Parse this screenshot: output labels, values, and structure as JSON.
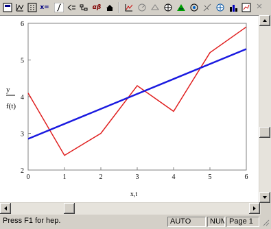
{
  "toolbar": {
    "buttons": [
      "calculator",
      "graph",
      "matrix",
      "evaluation",
      "calculus",
      "boolean",
      "programming",
      "greek",
      "symbolic"
    ],
    "buttons2": [
      "xy-plot",
      "polar-plot",
      "surface-plot",
      "contour-plot",
      "3d-scatter",
      "3d-bar",
      "vector-field"
    ],
    "eval_label": "x=",
    "greek_label": "αβ"
  },
  "plot": {
    "y_label_1": "y",
    "y_label_2": "f(t)",
    "x_label": "x,t",
    "x_ticks": [
      "0",
      "1",
      "2",
      "3",
      "4",
      "5",
      "6"
    ],
    "y_ticks": [
      "2",
      "3",
      "4",
      "5",
      "6"
    ]
  },
  "chart_data": {
    "type": "line",
    "xlim": [
      0,
      6
    ],
    "ylim": [
      2,
      6
    ],
    "xlabel": "x,t",
    "ylabel": "y / f(t)",
    "series": [
      {
        "color": "#e02020",
        "x": [
          0,
          1,
          2,
          3,
          4,
          5,
          6
        ],
        "values": [
          4.1,
          2.4,
          3.0,
          4.3,
          3.6,
          5.2,
          5.9
        ]
      },
      {
        "color": "#1a1ae0",
        "x": [
          0,
          6
        ],
        "values": [
          2.85,
          5.3
        ]
      }
    ]
  },
  "status": {
    "help": "Press F1 for hep.",
    "mode": "AUTO",
    "num": "NUM",
    "page": "Page 1"
  }
}
